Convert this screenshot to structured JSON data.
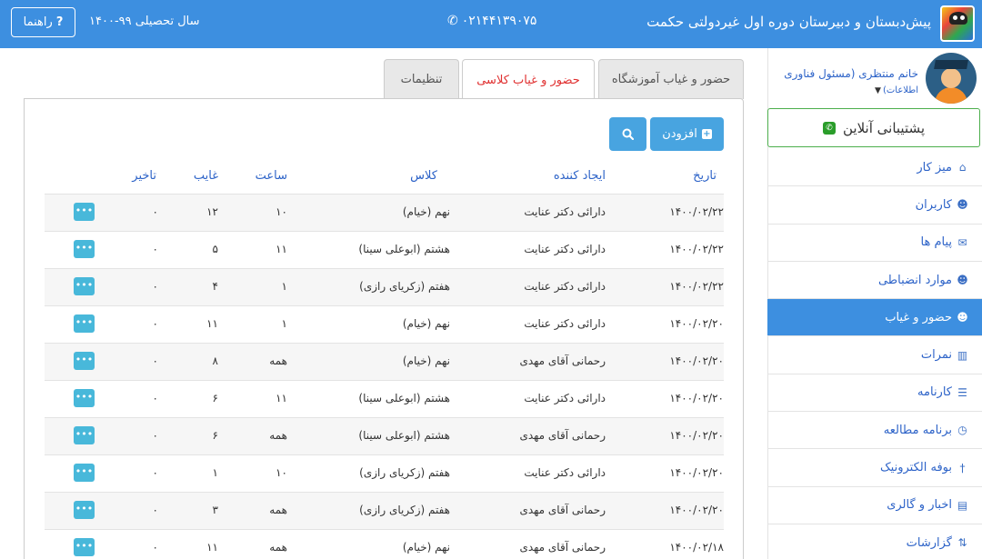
{
  "topbar": {
    "school_title": "پیش‌دبستان و دبیرستان دوره اول غیردولتی حکمت",
    "phone": "۰۲۱۴۴۱۳۹۰۷۵",
    "year_label": "سال تحصیلی ۹۹-۱۴۰۰",
    "help_label": "راهنما"
  },
  "profile": {
    "name": "خانم منتظری (مسئول فناوری",
    "role": "اطلاعات)"
  },
  "support_label": "پشتیبانی آنلاین",
  "menu": [
    {
      "label": "میز کار",
      "icon": "home-icon"
    },
    {
      "label": "کاربران",
      "icon": "user-icon"
    },
    {
      "label": "پیام ها",
      "icon": "envelope-icon"
    },
    {
      "label": "موارد انضباطی",
      "icon": "users-icon"
    },
    {
      "label": "حضور و غیاب",
      "icon": "users-icon",
      "active": true
    },
    {
      "label": "نمرات",
      "icon": "chart-icon"
    },
    {
      "label": "کارنامه",
      "icon": "list-icon"
    },
    {
      "label": "برنامه مطالعه",
      "icon": "clock-icon"
    },
    {
      "label": "بوفه الکترونیک",
      "icon": "cutlery-icon"
    },
    {
      "label": "اخبار و گالری",
      "icon": "film-icon"
    },
    {
      "label": "گزارشات",
      "icon": "sort-icon"
    }
  ],
  "tabs": [
    {
      "label": "حضور و غیاب آموزشگاه",
      "active": false
    },
    {
      "label": "حضور و غیاب کلاسی",
      "active": true
    },
    {
      "label": "تنظیمات",
      "active": false
    }
  ],
  "buttons": {
    "add_label": "افزودن"
  },
  "table": {
    "headers": {
      "date": "تاریخ",
      "creator": "ایجاد کننده",
      "class": "کلاس",
      "hour": "ساعت",
      "absent": "غایب",
      "late": "تاخیر"
    },
    "rows": [
      {
        "date": "۱۴۰۰/۰۲/۲۲",
        "creator": "دارائی دکتر عنایت",
        "class": "نهم (خیام)",
        "hour": "۱۰",
        "absent": "۱۲",
        "late": "۰"
      },
      {
        "date": "۱۴۰۰/۰۲/۲۲",
        "creator": "دارائی دکتر عنایت",
        "class": "هشتم (ابوعلی سینا)",
        "hour": "۱۱",
        "absent": "۵",
        "late": "۰"
      },
      {
        "date": "۱۴۰۰/۰۲/۲۲",
        "creator": "دارائی دکتر عنایت",
        "class": "هفتم (زکریای رازی)",
        "hour": "۱",
        "absent": "۴",
        "late": "۰"
      },
      {
        "date": "۱۴۰۰/۰۲/۲۰",
        "creator": "دارائی دکتر عنایت",
        "class": "نهم (خیام)",
        "hour": "۱",
        "absent": "۱۱",
        "late": "۰"
      },
      {
        "date": "۱۴۰۰/۰۲/۲۰",
        "creator": "رحمانی آقای مهدی",
        "class": "نهم (خیام)",
        "hour": "همه",
        "absent": "۸",
        "late": "۰"
      },
      {
        "date": "۱۴۰۰/۰۲/۲۰",
        "creator": "دارائی دکتر عنایت",
        "class": "هشتم (ابوعلی سینا)",
        "hour": "۱۱",
        "absent": "۶",
        "late": "۰"
      },
      {
        "date": "۱۴۰۰/۰۲/۲۰",
        "creator": "رحمانی آقای مهدی",
        "class": "هشتم (ابوعلی سینا)",
        "hour": "همه",
        "absent": "۶",
        "late": "۰"
      },
      {
        "date": "۱۴۰۰/۰۲/۲۰",
        "creator": "دارائی دکتر عنایت",
        "class": "هفتم (زکریای رازی)",
        "hour": "۱۰",
        "absent": "۱",
        "late": "۰"
      },
      {
        "date": "۱۴۰۰/۰۲/۲۰",
        "creator": "رحمانی آقای مهدی",
        "class": "هفتم (زکریای رازی)",
        "hour": "همه",
        "absent": "۳",
        "late": "۰"
      },
      {
        "date": "۱۴۰۰/۰۲/۱۸",
        "creator": "رحمانی آقای مهدی",
        "class": "نهم (خیام)",
        "hour": "همه",
        "absent": "۱۱",
        "late": "۰"
      }
    ]
  }
}
